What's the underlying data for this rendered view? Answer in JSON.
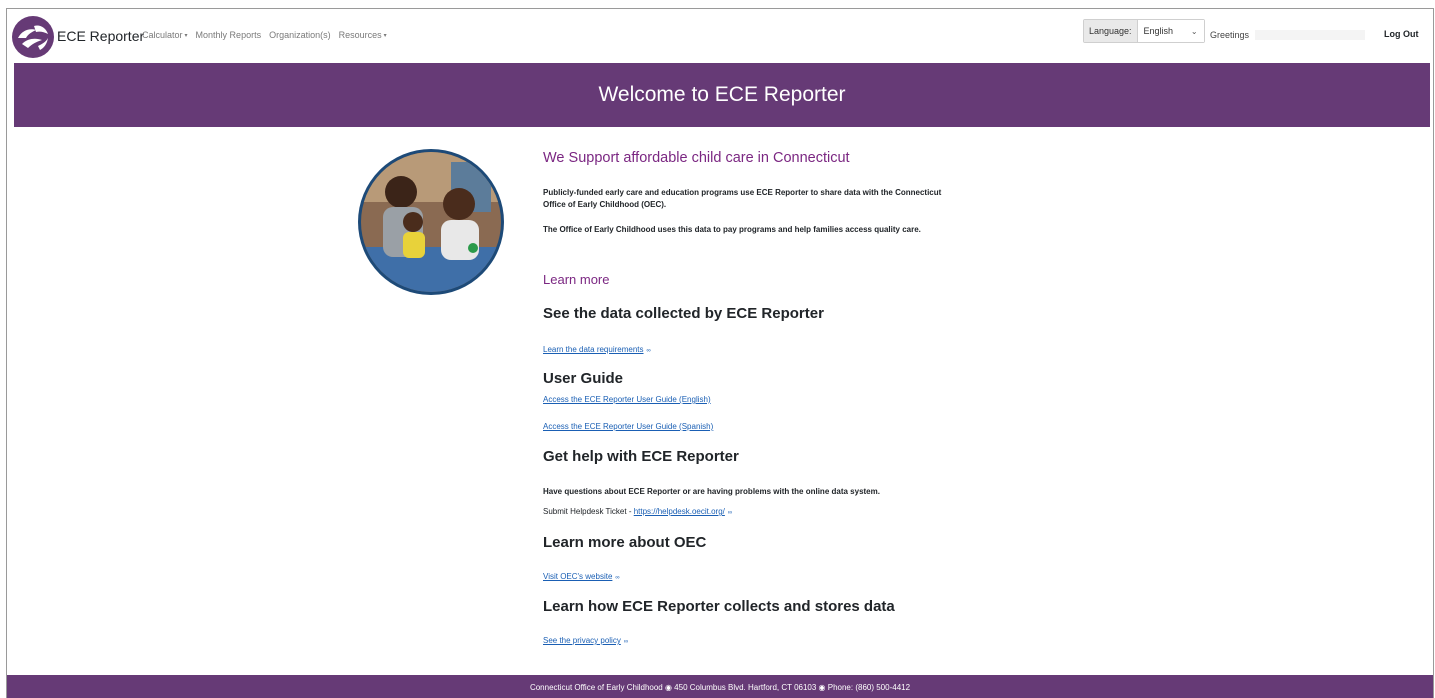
{
  "navbar": {
    "brand": "ECE Reporter",
    "items": [
      {
        "label": "Calculator",
        "dropdown": true
      },
      {
        "label": "Monthly Reports",
        "dropdown": false
      },
      {
        "label": "Organization(s)",
        "dropdown": false
      },
      {
        "label": "Resources",
        "dropdown": true
      }
    ],
    "language_label": "Language:",
    "language_value": "English",
    "greeting": "Greetings",
    "logout_label": "Log Out"
  },
  "banner": {
    "title": "Welcome to ECE Reporter"
  },
  "intro": {
    "heading": "We Support affordable child care in Connecticut",
    "paragraph1": "Publicly-funded early care and education programs use ECE Reporter to share data with the Connecticut Office of Early Childhood (OEC).",
    "paragraph2": "The Office of Early Childhood uses this data to pay programs and help families access quality care."
  },
  "learn_more": "Learn more",
  "sections": {
    "data_collected": {
      "heading": "See the data collected by ECE Reporter",
      "link": "Learn the data requirements"
    },
    "user_guide": {
      "heading": "User Guide",
      "link_english": "Access the ECE Reporter User Guide (English)",
      "link_spanish": "Access the ECE Reporter User Guide (Spanish)"
    },
    "help": {
      "heading": "Get help with ECE Reporter",
      "text": "Have questions about ECE Reporter or are having problems with the online data system.",
      "ticket_label": "Submit Helpdesk Ticket - ",
      "ticket_link": "https://helpdesk.oecit.org/"
    },
    "oec": {
      "heading": "Learn more about OEC",
      "link": "Visit OEC's website"
    },
    "privacy": {
      "heading": "Learn how ECE Reporter collects and stores data",
      "link": "See the privacy policy"
    }
  },
  "footer": {
    "text": "Connecticut Office of Early Childhood ◉ 450 Columbus Blvd. Hartford, CT 06103 ◉ Phone: (860) 500-4412"
  },
  "colors": {
    "primary": "#663a76",
    "accent_text": "#7b2782",
    "link": "#1a5fb4"
  },
  "icons": {
    "external_link": "∞",
    "dropdown_caret": "▾",
    "select_chevron": "⌄"
  }
}
